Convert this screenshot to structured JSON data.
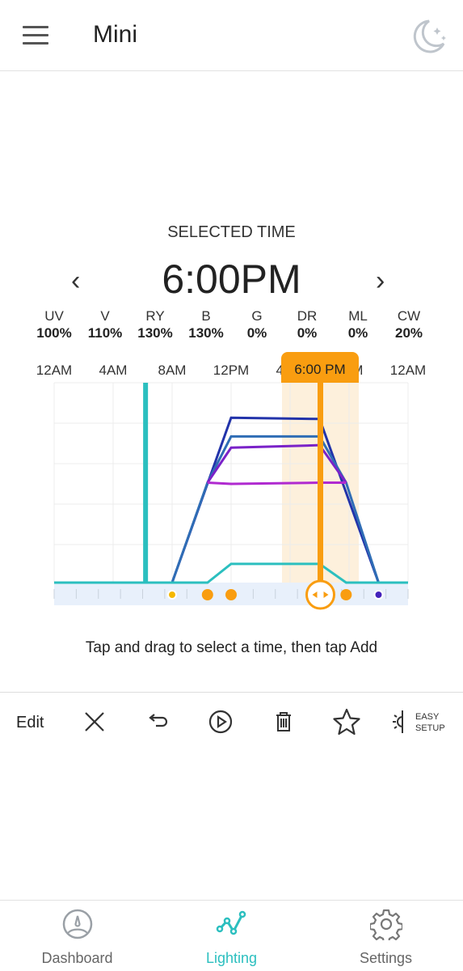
{
  "header": {
    "title": "Mini",
    "menu_icon": "hamburger-icon",
    "night_icon": "moon-stars-icon"
  },
  "selected_time": {
    "label": "SELECTED TIME",
    "value": "6:00PM",
    "prev_icon": "chevron-left-icon",
    "next_icon": "chevron-right-icon"
  },
  "channels": [
    {
      "name": "UV",
      "value": "100%"
    },
    {
      "name": "V",
      "value": "110%"
    },
    {
      "name": "RY",
      "value": "130%"
    },
    {
      "name": "B",
      "value": "130%"
    },
    {
      "name": "G",
      "value": "0%"
    },
    {
      "name": "DR",
      "value": "0%"
    },
    {
      "name": "ML",
      "value": "0%"
    },
    {
      "name": "CW",
      "value": "20%"
    }
  ],
  "colors": {
    "accent": "#f99d10",
    "teal": "#2bbfbf",
    "selection": "#fdf0dc"
  },
  "chart_data": {
    "type": "line",
    "x_ticks": [
      "12AM",
      "4AM",
      "8AM",
      "12PM",
      "4PM",
      "8PM",
      "12AM"
    ],
    "xlim": [
      0,
      24
    ],
    "ylim": [
      0,
      160
    ],
    "grid": true,
    "cursor_label": "6:00 PM",
    "cursor_hour": 18,
    "marker_hour": 6.2,
    "keyframes_hours": [
      8,
      10.4,
      12,
      19.8,
      22
    ],
    "series": [
      {
        "color": "#2233aa",
        "points": [
          [
            0,
            0
          ],
          [
            8,
            0
          ],
          [
            12,
            132
          ],
          [
            18,
            131
          ],
          [
            22,
            0
          ],
          [
            24,
            0
          ]
        ]
      },
      {
        "color": "#2f6db5",
        "points": [
          [
            8,
            0
          ],
          [
            10.4,
            80
          ],
          [
            12,
            117
          ],
          [
            18,
            117
          ],
          [
            19.8,
            80
          ],
          [
            22,
            0
          ]
        ]
      },
      {
        "color": "#7a22c8",
        "points": [
          [
            10.4,
            80
          ],
          [
            12,
            108
          ],
          [
            18,
            110
          ],
          [
            19.8,
            80
          ]
        ]
      },
      {
        "color": "#b02ad0",
        "points": [
          [
            10.4,
            80
          ],
          [
            12,
            79
          ],
          [
            18,
            80
          ],
          [
            19.8,
            80
          ]
        ]
      },
      {
        "color": "#2bbfbf",
        "points": [
          [
            0,
            0
          ],
          [
            10.4,
            0
          ],
          [
            12,
            15
          ],
          [
            18,
            15
          ],
          [
            19.8,
            0
          ],
          [
            24,
            0
          ]
        ]
      }
    ]
  },
  "hint": "Tap and drag to select a time, then tap Add",
  "toolbar": {
    "edit_label": "Edit",
    "easy_setup_line1": "EASY",
    "easy_setup_line2": "SETUP"
  },
  "bottom_nav": [
    {
      "label": "Dashboard"
    },
    {
      "label": "Lighting",
      "active": true
    },
    {
      "label": "Settings"
    }
  ]
}
